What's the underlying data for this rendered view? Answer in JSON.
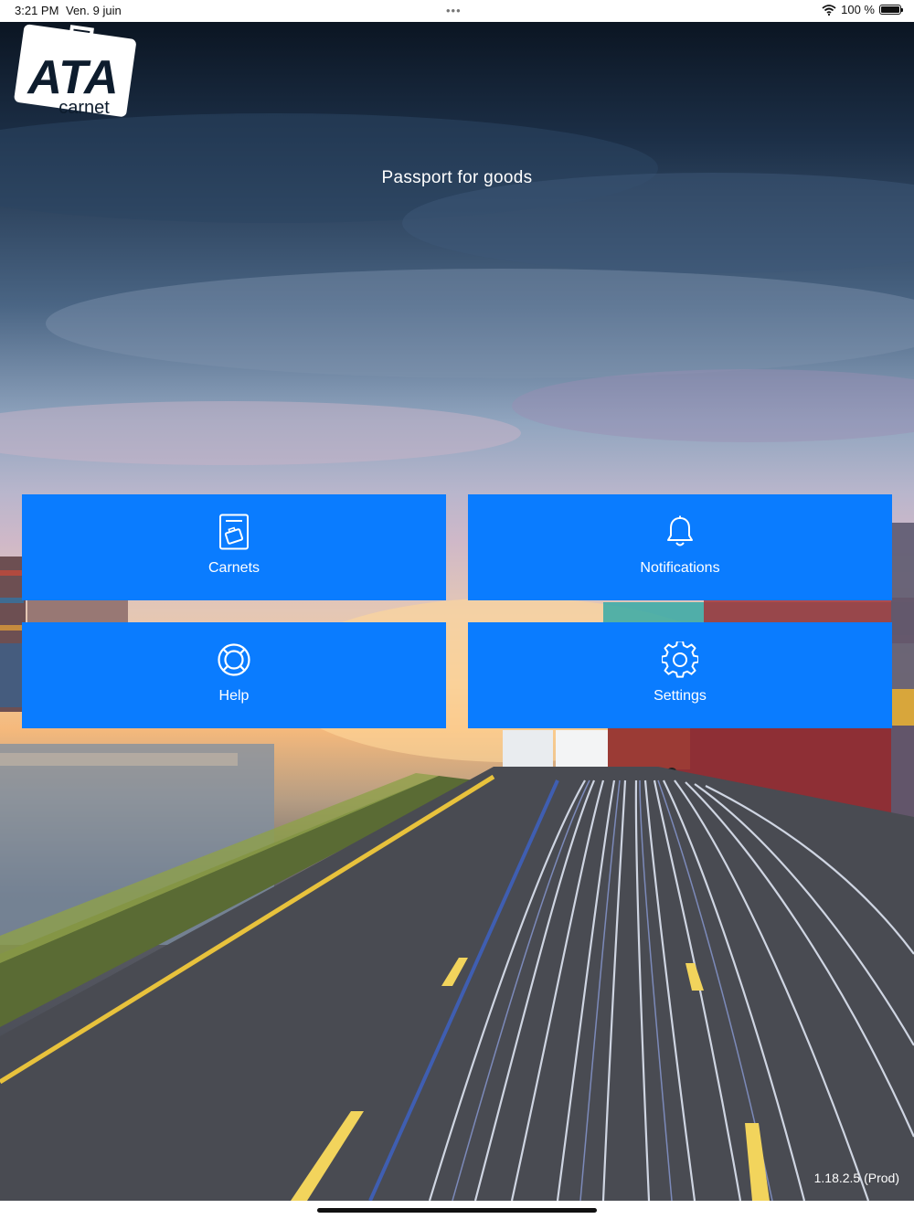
{
  "status_bar": {
    "time": "3:21 PM",
    "date": "Ven. 9 juin",
    "multitask_dots": "•••",
    "battery_label": "100 %",
    "battery_level": 1.0,
    "wifi_icon": "wifi-icon",
    "battery_icon": "battery-icon"
  },
  "brand": {
    "logo_text": "ATA",
    "logo_subtext": "carnet",
    "tagline": "Passport for goods"
  },
  "menu": {
    "tiles": [
      {
        "label": "Carnets",
        "icon": "carnet-document-icon"
      },
      {
        "label": "Notifications",
        "icon": "bell-icon"
      },
      {
        "label": "Help",
        "icon": "lifebuoy-icon"
      },
      {
        "label": "Settings",
        "icon": "gear-icon"
      }
    ],
    "tile_color": "#0a7cff"
  },
  "footer": {
    "version": "1.18.2.5 (Prod)"
  }
}
